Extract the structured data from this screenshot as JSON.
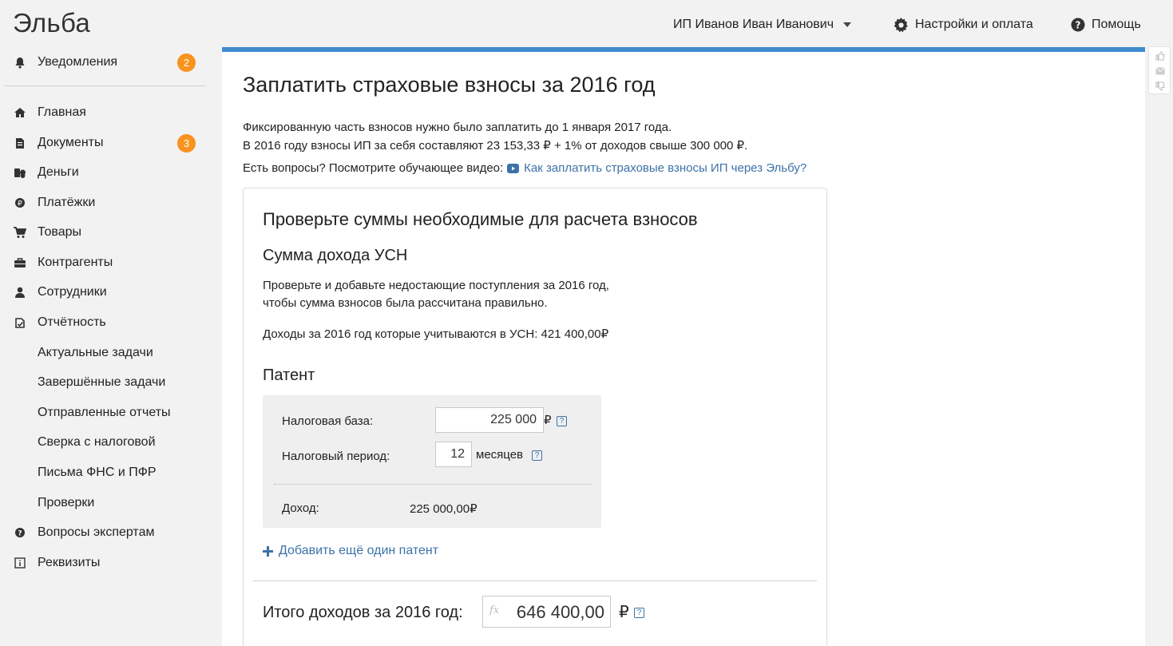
{
  "app": {
    "logo": "Эльба"
  },
  "header": {
    "user_name": "ИП Иванов Иван Иванович",
    "settings_label": "Настройки и оплата",
    "help_label": "Помощь"
  },
  "sidebar": {
    "notifications": {
      "label": "Уведомления",
      "badge": "2",
      "icon": "bell-icon"
    },
    "items": [
      {
        "label": "Главная",
        "icon": "home-icon"
      },
      {
        "label": "Документы",
        "icon": "document-icon",
        "badge": "3"
      },
      {
        "label": "Деньги",
        "icon": "money-icon"
      },
      {
        "label": "Платёжки",
        "icon": "payment-icon"
      },
      {
        "label": "Товары",
        "icon": "cart-icon"
      },
      {
        "label": "Контрагенты",
        "icon": "briefcase-icon"
      },
      {
        "label": "Сотрудники",
        "icon": "person-icon"
      },
      {
        "label": "Отчётность",
        "icon": "report-icon"
      },
      {
        "label": "Актуальные задачи"
      },
      {
        "label": "Завершённые задачи"
      },
      {
        "label": "Отправленные отчеты"
      },
      {
        "label": "Сверка с налоговой"
      },
      {
        "label": "Письма ФНС и ПФР"
      },
      {
        "label": "Проверки"
      },
      {
        "label": "Вопросы экспертам",
        "icon": "question-icon"
      },
      {
        "label": "Реквизиты",
        "icon": "info-icon"
      }
    ]
  },
  "main": {
    "title": "Заплатить страховые взносы за 2016 год",
    "intro_line1": "Фиксированную часть взносов нужно было заплатить до 1 января 2017 года.",
    "intro_line2": "В 2016 году взносы ИП за себя составляют 23 153,33 ₽ + 1% от доходов свыше 300 000 ₽.",
    "video_prompt": "Есть вопросы? Посмотрите обучающее видео:",
    "video_link": "Как заплатить страховые взносы ИП через Эльбу?",
    "panel": {
      "title": "Проверьте суммы необходимые для расчета взносов",
      "usn_title": "Сумма дохода УСН",
      "usn_link": "Проверьте и добавьте недостающие поступления за 2016 год,",
      "usn_note": "чтобы сумма взносов была рассчитана правильно.",
      "usn_income": "Доходы за 2016 год которые учитываются в УСН: 421 400,00₽",
      "patent_title": "Патент",
      "tax_base_label": "Налоговая база:",
      "tax_base_value": "225 000",
      "currency": "₽",
      "tax_period_label": "Налоговый период:",
      "tax_period_value": "12",
      "months_label": "месяцев",
      "income_label": "Доход:",
      "income_value": "225 000,00₽",
      "add_patent": "Добавить ещё один патент",
      "total_label": "Итого доходов за 2016 год:",
      "total_value": "646 400,00",
      "fx": "fx"
    }
  },
  "colors": {
    "accent": "#3f8bd0",
    "link": "#3c72a8",
    "badge": "#f7931e"
  }
}
